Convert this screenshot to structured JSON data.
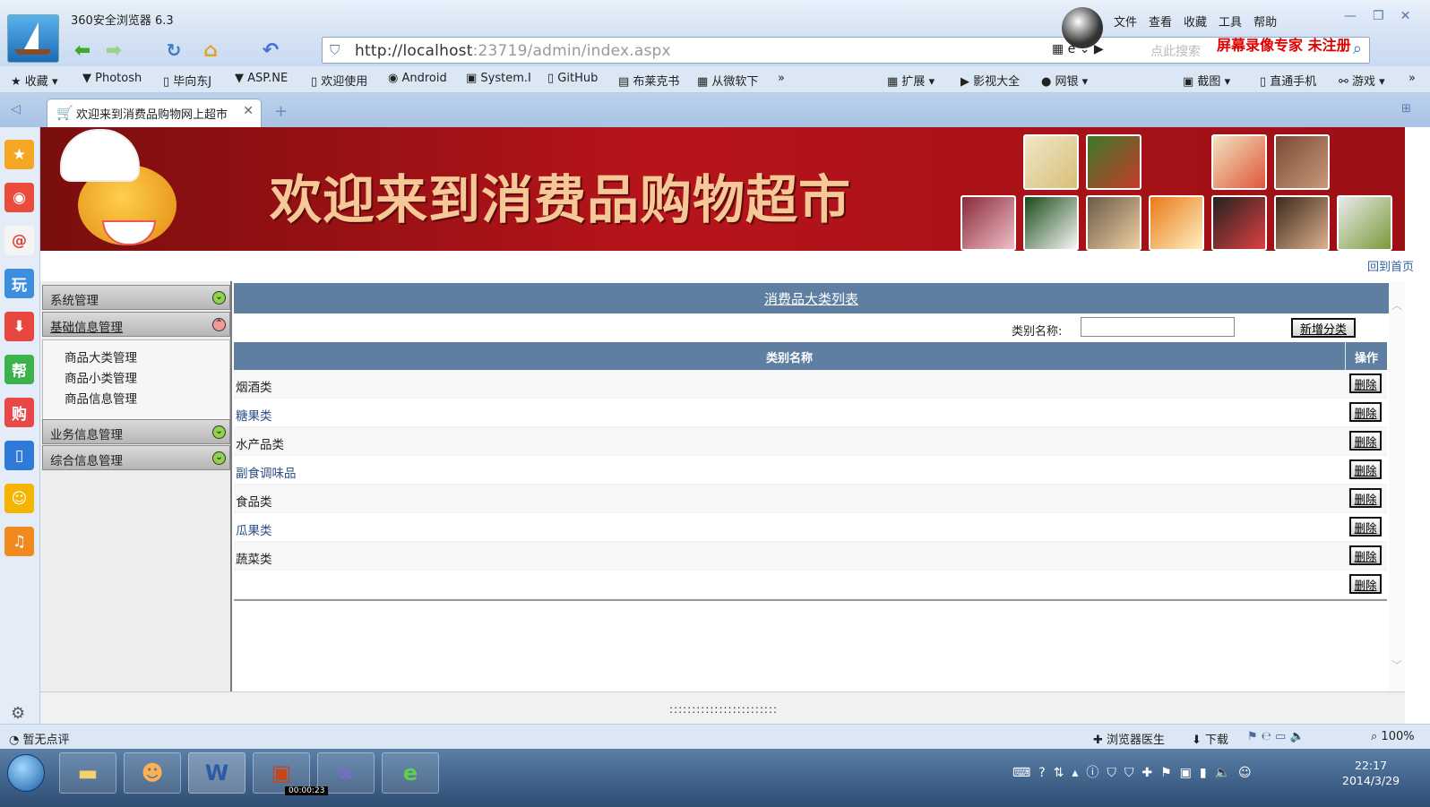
{
  "browser": {
    "app_title": "360安全浏览器 6.3",
    "menus": [
      "文件",
      "查看",
      "收藏",
      "工具",
      "帮助"
    ],
    "watermark": "屏幕录像专家 未注册",
    "address": {
      "host": "http://localhost",
      "rest": ":23719/admin/index.aspx"
    },
    "search_placeholder": "点此搜索",
    "bookmarks": [
      "收藏",
      "Photosh",
      "毕向东J",
      "ASP.NE",
      "欢迎使用",
      "Android",
      "System.I",
      "GitHub",
      "布莱克书",
      "从微软下",
      "»"
    ],
    "bookmarks_right": [
      "扩展",
      "影视大全",
      "网银",
      "",
      "截图",
      "直通手机",
      "游戏",
      "»"
    ],
    "tab_title": "欢迎来到消费品购物网上超市",
    "status_left": "暂无点评",
    "status_right": [
      "浏览器医生",
      "下载",
      "100%"
    ]
  },
  "page": {
    "banner_title": "欢迎来到消费品购物超市",
    "back_home": "回到首页",
    "left_menu": {
      "sections": [
        {
          "label": "系统管理",
          "state": "collapsed"
        },
        {
          "label": "基础信息管理",
          "state": "expanded"
        },
        {
          "label": "业务信息管理",
          "state": "collapsed"
        },
        {
          "label": "综合信息管理",
          "state": "collapsed"
        }
      ],
      "sub_items": [
        "商品大类管理",
        "商品小类管理",
        "商品信息管理"
      ]
    },
    "main": {
      "title": "消费品大类列表",
      "filter_label": "类别名称:",
      "filter_value": "",
      "add_button": "新增分类",
      "columns": [
        "类别名称",
        "操作"
      ],
      "rows": [
        {
          "name": "烟酒类",
          "link": false
        },
        {
          "name": "糖果类",
          "link": true
        },
        {
          "name": "水产品类",
          "link": false
        },
        {
          "name": "副食调味品",
          "link": true
        },
        {
          "name": "食品类",
          "link": false
        },
        {
          "name": "瓜果类",
          "link": true
        },
        {
          "name": "蔬菜类",
          "link": false
        },
        {
          "name": "",
          "link": false
        }
      ],
      "delete_label": "删除"
    },
    "bottom_handle": "::::::::::::::::::::::::"
  },
  "taskbar": {
    "time": "22:17",
    "date": "2014/3/29",
    "recorder": "00:00:23"
  },
  "colors": {
    "header_blue": "#5e7fa2",
    "banner_red": "#b6141a",
    "link_blue": "#2d4e86"
  }
}
